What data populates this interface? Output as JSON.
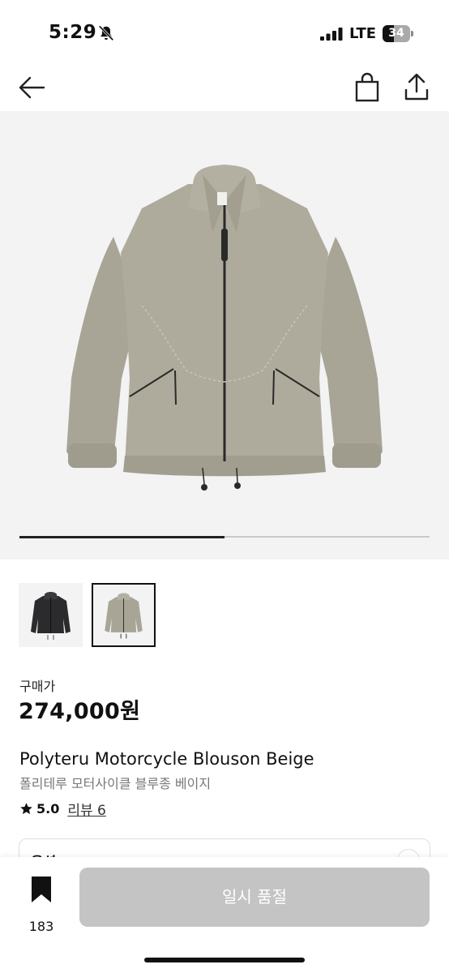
{
  "status_bar": {
    "time": "5:29",
    "network": "LTE",
    "battery": "34"
  },
  "icons": {
    "back": "arrow-left-icon",
    "bag": "shopping-bag-icon",
    "share": "share-icon",
    "bell": "bell-slash-icon",
    "star": "star-icon",
    "bookmark": "bookmark-icon"
  },
  "gallery": {
    "progress": 0.5,
    "thumbnails": [
      "black",
      "beige"
    ],
    "selected_thumbnail": 1
  },
  "product": {
    "price_label": "구매가",
    "price": "274,000원",
    "name": "Polyteru Motorcycle Blouson Beige",
    "subname": "폴리테루 모터사이클 블루종 베이지",
    "rating": "5.0",
    "review_link": "리뷰 6"
  },
  "option": {
    "label": "옵션"
  },
  "bottom_bar": {
    "bookmark_count": "183",
    "cta_label": "일시 품절"
  },
  "colors": {
    "jacket_beige": "#a8a597",
    "jacket_black": "#2b2b2d",
    "cta_disabled": "#c4c4c4",
    "hero_bg": "#f3f3f3"
  }
}
